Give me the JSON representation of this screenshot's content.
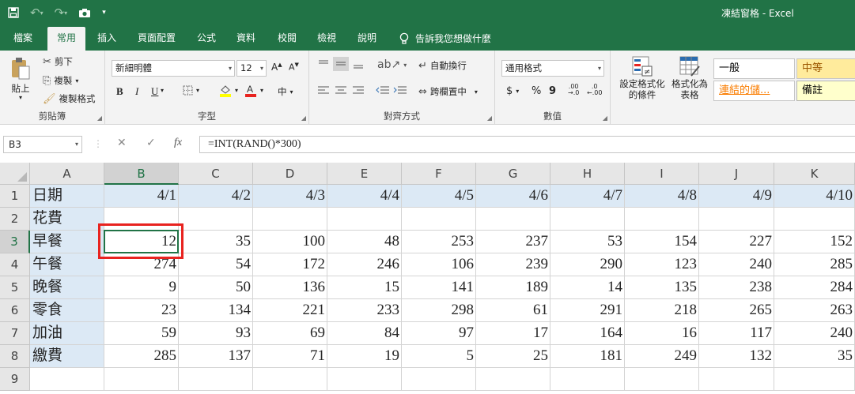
{
  "window": {
    "title": "凍結窗格 - Excel"
  },
  "tabs": [
    "檔案",
    "常用",
    "插入",
    "頁面配置",
    "公式",
    "資料",
    "校閱",
    "檢視",
    "說明"
  ],
  "tell_me": "告訴我您想做什麼",
  "ribbon": {
    "clipboard": {
      "label": "剪貼簿",
      "paste": "貼上",
      "cut": "剪下",
      "copy": "複製",
      "format_painter": "複製格式"
    },
    "font": {
      "label": "字型",
      "font_name": "新細明體",
      "font_size": "12",
      "bold": "B",
      "italic": "I",
      "underline": "U",
      "phonetic": "中"
    },
    "alignment": {
      "label": "對齊方式",
      "wrap_text": "自動換行",
      "merge_center": "跨欄置中"
    },
    "number": {
      "label": "數值",
      "format": "通用格式",
      "currency": "$",
      "percent": "%",
      "comma": "9",
      "inc_decimal": ".00",
      "dec_decimal": ".0"
    },
    "styles": {
      "conditional_formatting": "設定格式化的條件",
      "format_as_table": "格式化為表格",
      "normal": "一般",
      "neutral": "中等",
      "linked_cell": "連結的儲...",
      "note": "備註"
    }
  },
  "formula_bar": {
    "name_box": "B3",
    "formula": "=INT(RAND()*300)",
    "fx": "fx"
  },
  "sheet": {
    "columns": [
      "A",
      "B",
      "C",
      "D",
      "E",
      "F",
      "G",
      "H",
      "I",
      "J",
      "K"
    ],
    "row_numbers": [
      "1",
      "2",
      "3",
      "4",
      "5",
      "6",
      "7",
      "8",
      "9"
    ],
    "rows": [
      [
        "日期",
        "4/1",
        "4/2",
        "4/3",
        "4/4",
        "4/5",
        "4/6",
        "4/7",
        "4/8",
        "4/9",
        "4/10"
      ],
      [
        "花費",
        "",
        "",
        "",
        "",
        "",
        "",
        "",
        "",
        "",
        ""
      ],
      [
        "早餐",
        "12",
        "35",
        "100",
        "48",
        "253",
        "237",
        "53",
        "154",
        "227",
        "152"
      ],
      [
        "午餐",
        "274",
        "54",
        "172",
        "246",
        "106",
        "239",
        "290",
        "123",
        "240",
        "285"
      ],
      [
        "晚餐",
        "9",
        "50",
        "136",
        "15",
        "141",
        "189",
        "14",
        "135",
        "238",
        "284"
      ],
      [
        "零食",
        "23",
        "134",
        "221",
        "233",
        "298",
        "61",
        "291",
        "218",
        "265",
        "263"
      ],
      [
        "加油",
        "59",
        "93",
        "69",
        "84",
        "97",
        "17",
        "164",
        "16",
        "117",
        "240"
      ],
      [
        "繳費",
        "285",
        "137",
        "71",
        "19",
        "5",
        "25",
        "181",
        "249",
        "132",
        "35"
      ],
      [
        "",
        "",
        "",
        "",
        "",
        "",
        "",
        "",
        "",
        "",
        ""
      ]
    ],
    "active_cell": "B3",
    "colors": {
      "accent": "#217346",
      "label_fill": "#dce9f5",
      "highlight": "#e8231f"
    }
  }
}
